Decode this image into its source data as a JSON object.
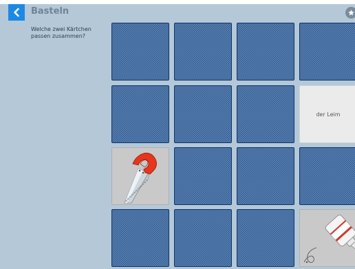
{
  "header": {
    "title": "Basteln",
    "back_icon": "chevron-left-icon",
    "star_icon": "star-icon",
    "accent_color": "#1e88e5"
  },
  "instruction": "Welche zwei Kärtchen passen zusammen?",
  "game": {
    "rows": 4,
    "columns": 4,
    "card_back_color": "#1b4a86",
    "cards": [
      {
        "row": 0,
        "col": 0,
        "state": "face-down"
      },
      {
        "row": 0,
        "col": 1,
        "state": "face-down"
      },
      {
        "row": 0,
        "col": 2,
        "state": "face-down"
      },
      {
        "row": 0,
        "col": 3,
        "state": "face-down"
      },
      {
        "row": 1,
        "col": 0,
        "state": "face-down"
      },
      {
        "row": 1,
        "col": 1,
        "state": "face-down"
      },
      {
        "row": 1,
        "col": 2,
        "state": "face-down"
      },
      {
        "row": 1,
        "col": 3,
        "state": "face-up",
        "text": "der Leim"
      },
      {
        "row": 2,
        "col": 0,
        "state": "face-up",
        "image": "saw-icon"
      },
      {
        "row": 2,
        "col": 1,
        "state": "face-down"
      },
      {
        "row": 2,
        "col": 2,
        "state": "face-down"
      },
      {
        "row": 2,
        "col": 3,
        "state": "face-down"
      },
      {
        "row": 3,
        "col": 0,
        "state": "face-down"
      },
      {
        "row": 3,
        "col": 1,
        "state": "face-down"
      },
      {
        "row": 3,
        "col": 2,
        "state": "face-down"
      },
      {
        "row": 3,
        "col": 3,
        "state": "face-up",
        "image": "glue-bottle-icon"
      }
    ]
  }
}
